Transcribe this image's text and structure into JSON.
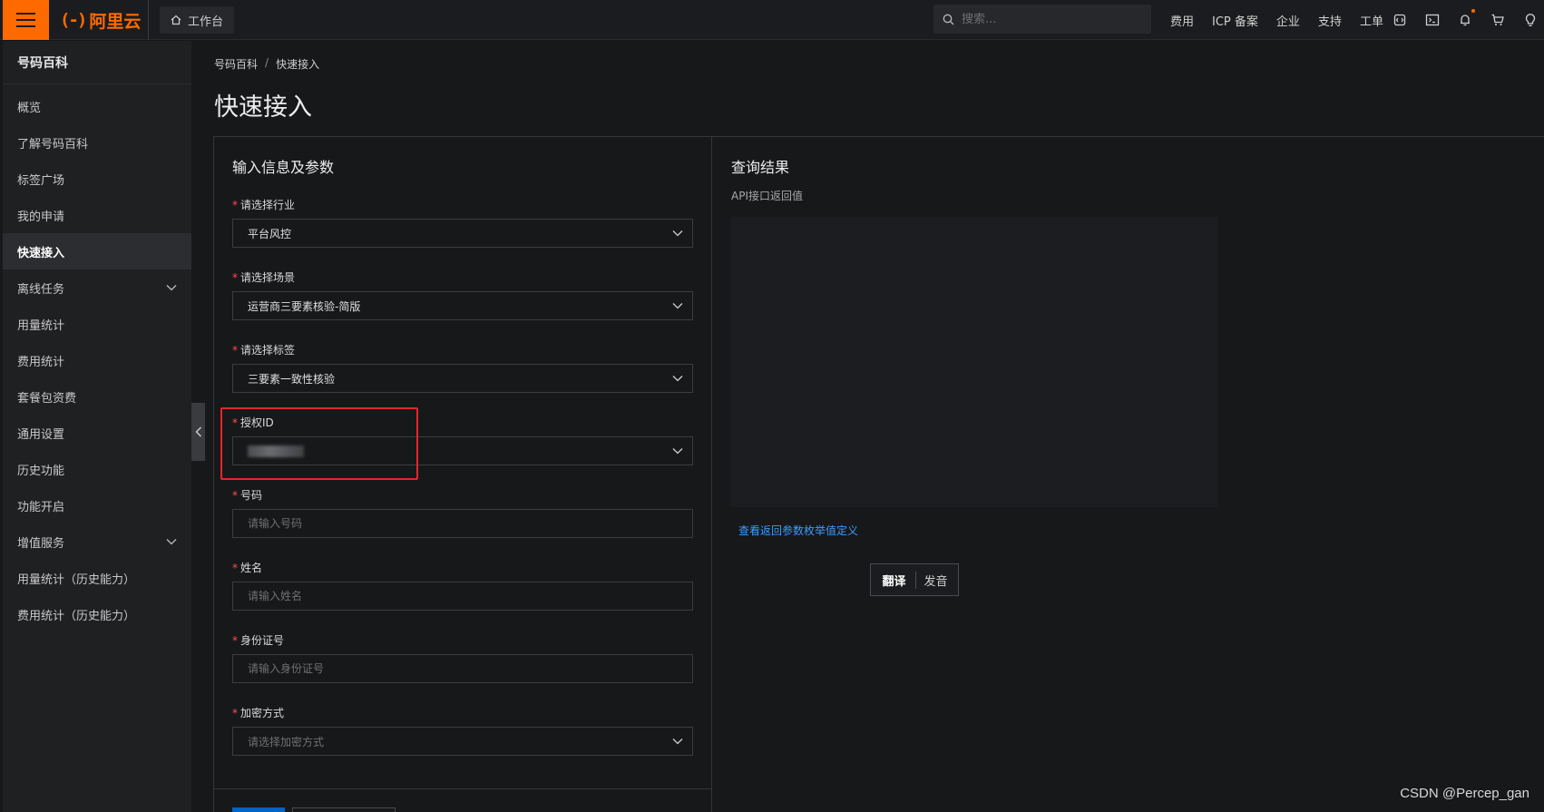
{
  "topbar": {
    "logo_text": "阿里云",
    "logo_mark": "(-)",
    "workbench_label": "工作台",
    "search_placeholder": "搜索...",
    "links": [
      "费用",
      "ICP 备案",
      "企业",
      "支持",
      "工单"
    ],
    "icons": [
      "code-icon",
      "terminal-icon",
      "bell-icon",
      "cart-icon",
      "lightbulb-icon"
    ],
    "accent_color": "#ff6a00"
  },
  "sidebar": {
    "title": "号码百科",
    "items": [
      {
        "label": "概览"
      },
      {
        "label": "了解号码百科"
      },
      {
        "label": "标签广场"
      },
      {
        "label": "我的申请"
      },
      {
        "label": "快速接入",
        "active": true
      },
      {
        "label": "离线任务",
        "expandable": true
      },
      {
        "label": "用量统计"
      },
      {
        "label": "费用统计"
      },
      {
        "label": "套餐包资费"
      },
      {
        "label": "通用设置"
      },
      {
        "label": "历史功能"
      },
      {
        "label": "功能开启"
      },
      {
        "label": "增值服务",
        "expandable": true
      },
      {
        "label": "用量统计（历史能力）"
      },
      {
        "label": "费用统计（历史能力）"
      }
    ]
  },
  "breadcrumb": {
    "root": "号码百科",
    "separator": "/",
    "current": "快速接入"
  },
  "page": {
    "title": "快速接入"
  },
  "form": {
    "title": "输入信息及参数",
    "industry": {
      "label": "请选择行业",
      "value": "平台风控"
    },
    "scene": {
      "label": "请选择场景",
      "value": "运营商三要素核验-简版"
    },
    "tag": {
      "label": "请选择标签",
      "value": "三要素一致性核验"
    },
    "auth_id": {
      "label": "授权ID",
      "value_redacted": true
    },
    "phone": {
      "label": "号码",
      "placeholder": "请输入号码"
    },
    "name": {
      "label": "姓名",
      "placeholder": "请输入姓名"
    },
    "id_card": {
      "label": "身份证号",
      "placeholder": "请输入身份证号"
    },
    "encryption": {
      "label": "加密方式",
      "placeholder": "请选择加密方式"
    },
    "required_mark": "*"
  },
  "result": {
    "title": "查询结果",
    "subtitle": "API接口返回值",
    "link": "查看返回参数枚举值定义"
  },
  "translate_popup": {
    "translate": "翻译",
    "pronounce": "发音"
  },
  "watermark": "CSDN @Percep_gan",
  "colors": {
    "required": "#ff4d4f",
    "link": "#3f9bff",
    "highlight_border": "#e8252b",
    "primary_button": "#0064c8"
  }
}
